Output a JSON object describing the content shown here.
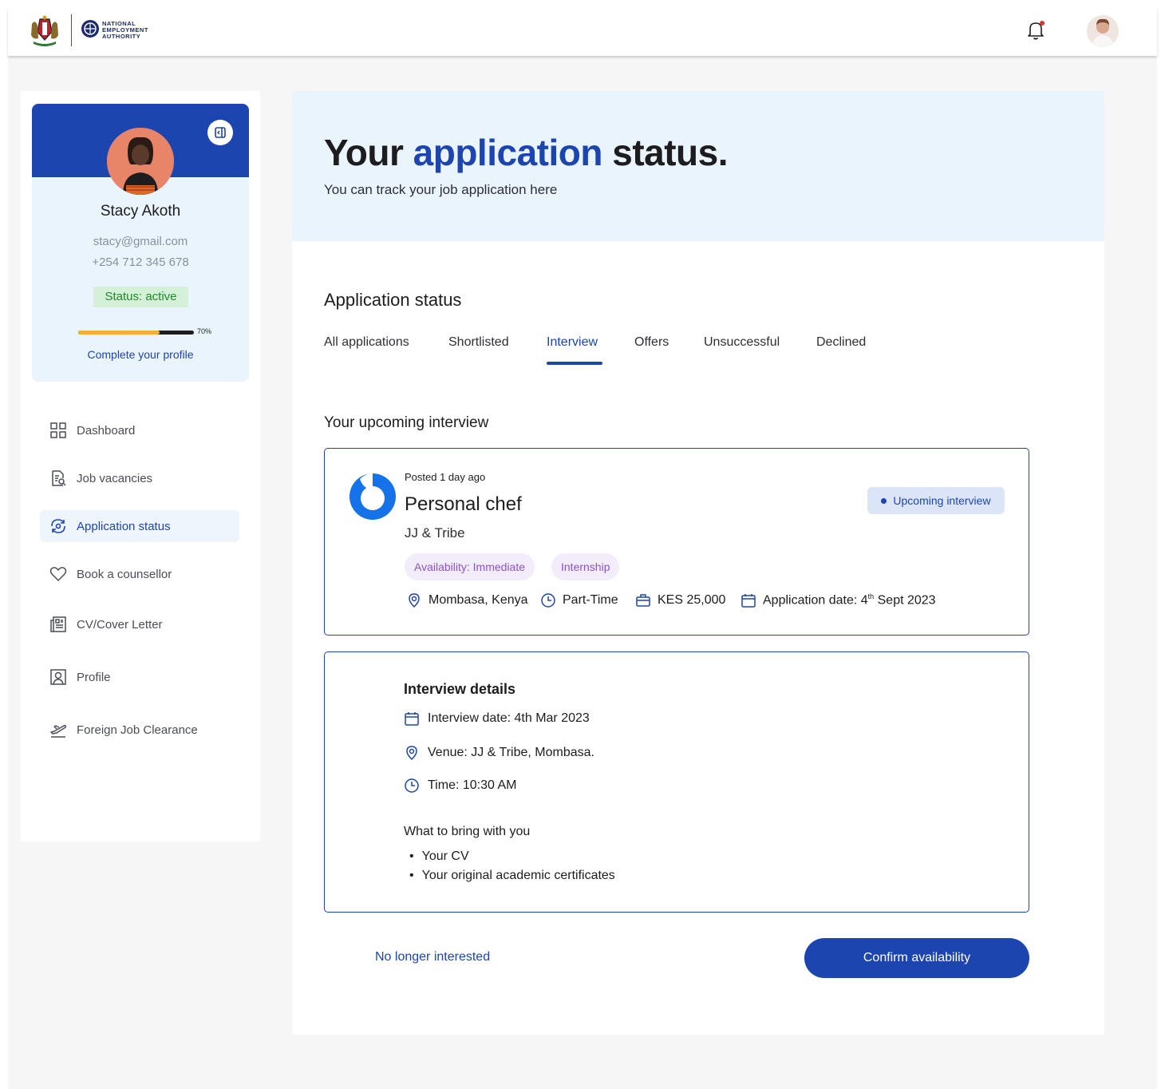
{
  "header": {
    "coat_of_arms_caption": "REPUBLIC OF KENYA",
    "agency_name_line1": "NATIONAL",
    "agency_name_line2": "EMPLOYMENT",
    "agency_name_line3": "AUTHORITY",
    "notification_icon": "bell-icon",
    "has_unread_notifications": true
  },
  "profile": {
    "name": "Stacy Akoth",
    "email": "stacy@gmail.com",
    "phone": "+254 712 345 678",
    "status": "Status: active",
    "progress_percent": 70,
    "progress_label": "70%",
    "complete_profile_link": "Complete your profile"
  },
  "sidebar": {
    "items": [
      {
        "label": "Dashboard",
        "icon": "grid-icon"
      },
      {
        "label": "Job vacancies",
        "icon": "document-search-icon"
      },
      {
        "label": "Application status",
        "icon": "refresh-search-icon",
        "active": true
      },
      {
        "label": "Book a counsellor",
        "icon": "heart-icon"
      },
      {
        "label": "CV/Cover Letter",
        "icon": "newspaper-icon"
      },
      {
        "label": "Profile",
        "icon": "user-square-icon"
      },
      {
        "label": "Foreign Job Clearance",
        "icon": "airplane-icon"
      }
    ]
  },
  "hero": {
    "title_part1": "Your ",
    "title_accent": "application",
    "title_part2": " status.",
    "subtitle": "You can track your job application here"
  },
  "main": {
    "section_title": "Application status",
    "tabs": [
      {
        "label": "All applications"
      },
      {
        "label": "Shortlisted"
      },
      {
        "label": "Interview",
        "active": true
      },
      {
        "label": "Offers"
      },
      {
        "label": "Unsuccessful"
      },
      {
        "label": "Declined"
      }
    ],
    "upcoming_title": "Your upcoming interview"
  },
  "job": {
    "posted": "Posted 1 day ago",
    "title": "Personal chef",
    "company": "JJ & Tribe",
    "status_badge": "Upcoming interview",
    "tags": [
      "Availability: Immediate",
      "Internship"
    ],
    "location": "Mombasa, Kenya",
    "job_type": "Part-Time",
    "salary": "KES 25,000",
    "application_date_prefix": "Application date: 4",
    "application_date_sup": "th",
    "application_date_suffix": " Sept 2023"
  },
  "interview": {
    "title": "Interview details",
    "date": "Interview date: 4th Mar 2023",
    "venue": "Venue: JJ & Tribe, Mombasa.",
    "time": "Time: 10:30 AM",
    "bring_title": "What to bring with you",
    "bring_items": [
      "Your CV",
      "Your original academic certificates"
    ]
  },
  "actions": {
    "decline_label": "No longer interested",
    "confirm_label": "Confirm availability"
  },
  "colors": {
    "primary": "#1d45b0",
    "hero_bg": "#eaf4fd",
    "status_green": "#1e8a2c",
    "progress_yellow": "#f2b033",
    "tag_purple": "#8a54c9"
  }
}
